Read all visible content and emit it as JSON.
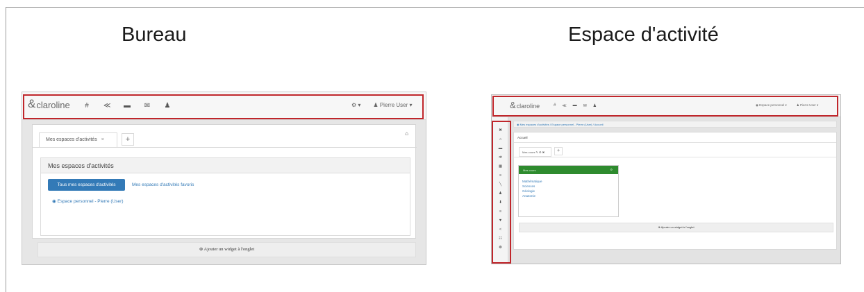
{
  "titles": {
    "left": "Bureau",
    "right": "Espace d'activité"
  },
  "colors": {
    "highlight": "#c0262b",
    "primary": "#337ab7",
    "widget_header": "#2e8b2e",
    "navbar": "#f7f7f7"
  },
  "bureau": {
    "logo": {
      "mark": "&",
      "text": "claroline"
    },
    "nav_icons": [
      "home-icon",
      "share-icon",
      "folder-icon",
      "inbox-icon",
      "user-icon"
    ],
    "nav_glyphs": [
      "#",
      "≪",
      "▬",
      "✉",
      "♟"
    ],
    "notifications": "⚙ ▾",
    "user_menu": "♟ Pierre User ▾",
    "tab_label": "Mes espaces d'activités",
    "tab_close": "×",
    "tab_add": "+",
    "lock": "⌂",
    "widget_title": "Mes espaces d'activités",
    "btn_all": "Tous mes espaces d'activités",
    "link_favorites": "Mes espaces d'activités favoris",
    "link_personal": "◉ Espace personnel - Pierre (User)",
    "add_widget": "⊕ Ajouter un widget à l'onglet"
  },
  "espace": {
    "logo": {
      "mark": "&",
      "text": "claroline"
    },
    "nav_glyphs": [
      "#",
      "≪",
      "▬",
      "✉",
      "♟"
    ],
    "workspace_menu": "◉ Espace personnel ▾",
    "user_menu": "♟ Pierre User ▾",
    "breadcrumb": "◉ Mes espaces d'activités / Espace personnel - Pierre (User) / Accueil",
    "home_title": "Accueil",
    "tab_label": "Mes cours ✎ ⚙ ✖",
    "tab_add": "+",
    "widget_title": "Mes cours",
    "widget_cfg": "⚙",
    "courses": [
      "Mathématique",
      "Sciences",
      "Géologie",
      "Anatomie"
    ],
    "sidebar_icons": [
      "close-icon",
      "home-icon",
      "folder-icon",
      "share-icon",
      "calendar-icon",
      "list-icon",
      "chart-icon",
      "user-icon",
      "download-icon",
      "list-icon",
      "filter-icon",
      "share-icon",
      "forum-icon",
      "gear-icon"
    ],
    "sidebar_glyphs": [
      "✖",
      "⌂",
      "▬",
      "≪",
      "▦",
      "≡",
      "╲",
      "♟",
      "⬇",
      "≡",
      "▼",
      "<",
      "☷",
      "☸"
    ],
    "add_widget": "⊕ Ajouter un widget à l'onglet"
  }
}
